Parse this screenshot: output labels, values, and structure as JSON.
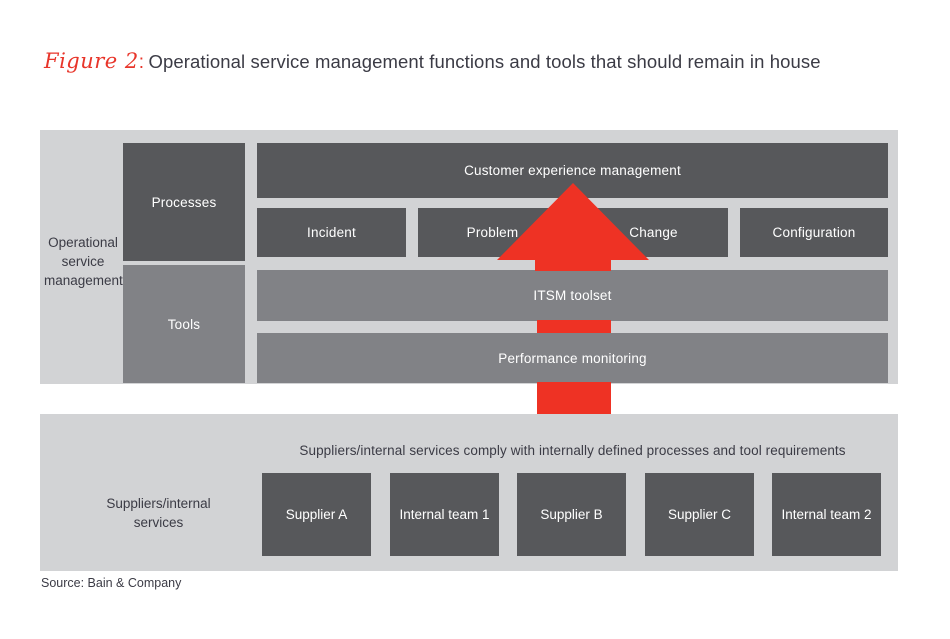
{
  "figure": {
    "label": "Figure 2",
    "colon": ":",
    "title": "Operational service management functions and tools that should remain in house"
  },
  "colors": {
    "accent_red": "#ee3224",
    "title_red": "#e8352a",
    "panel_gray": "#d2d3d5",
    "box_dark": "#57585b",
    "box_light": "#818286",
    "text_dark": "#3b3b45",
    "text_light": "#ffffff",
    "page_background": "#ffffff"
  },
  "top_panel": {
    "side_label": "Operational service management",
    "row_labels": {
      "processes": "Processes",
      "tools": "Tools"
    },
    "customer_experience": "Customer experience management",
    "process_items": [
      "Incident",
      "Problem",
      "Change",
      "Configuration"
    ],
    "tool_items": [
      "ITSM toolset",
      "Performance monitoring"
    ]
  },
  "arrow": {
    "name": "upward-red-arrow",
    "direction": "up",
    "color": "#ee3224"
  },
  "bottom_panel": {
    "side_label": "Suppliers/internal services",
    "note": "Suppliers/internal services comply with internally defined processes and tool requirements",
    "entities": [
      "Supplier A",
      "Internal team 1",
      "Supplier B",
      "Supplier C",
      "Internal team 2"
    ]
  },
  "footer": {
    "source": "Source: Bain & Company"
  }
}
